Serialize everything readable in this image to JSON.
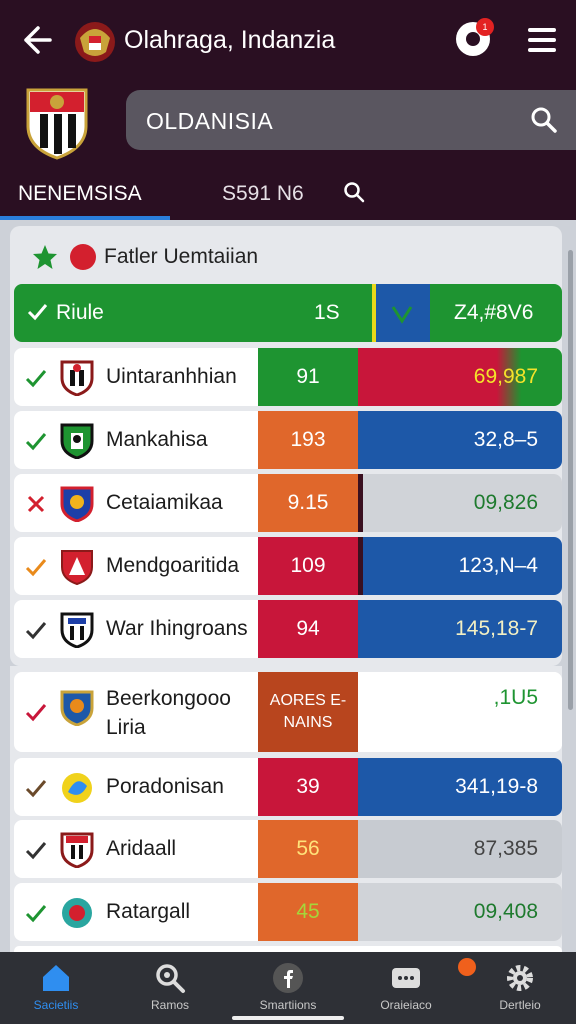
{
  "header": {
    "title": "Olahraga, Indanzia",
    "notification_count": "1",
    "search_value": "OLDANISIA",
    "tabs": [
      {
        "label": "NENEMSISA"
      },
      {
        "label": "S591 N6"
      }
    ]
  },
  "panel": {
    "title": "Fatler Uemtaiian",
    "header_row": {
      "label": "Riule",
      "count": "1S",
      "value": "Z4,#8V6"
    }
  },
  "rows": [
    {
      "mark": "check",
      "team": "Uintaranhhian",
      "count": "91",
      "score": "69,987"
    },
    {
      "mark": "check",
      "team": "Mankahisa",
      "count": "193",
      "score": "32,8–5"
    },
    {
      "mark": "cross",
      "team": "Cetaiamikaa",
      "count": "9.15",
      "score": "09,826"
    },
    {
      "mark": "check",
      "team": "Mendgoaritida",
      "count": "109",
      "score": "123,N–4"
    },
    {
      "mark": "check",
      "team": "War Ihingroans",
      "count": "94",
      "score": "145,18-7"
    },
    {
      "mark": "check",
      "team": "Beerkongooo Liria",
      "count": "AORES E-NAINS",
      "score": ",1U5"
    },
    {
      "mark": "check",
      "team": "Poradonisan",
      "count": "39",
      "score": "341,19-8"
    },
    {
      "mark": "check",
      "team": "Aridaall",
      "count": "56",
      "score": "87,385"
    },
    {
      "mark": "check",
      "team": "Ratargall",
      "count": "45",
      "score": "09,408"
    }
  ],
  "nav": [
    {
      "label": "Sacietiis",
      "icon": "home-icon"
    },
    {
      "label": "Ramos",
      "icon": "search-person-icon"
    },
    {
      "label": "Smartiions",
      "icon": "facebook-icon"
    },
    {
      "label": "Oraieiaco",
      "icon": "chat-icon"
    },
    {
      "label": "Dertleio",
      "icon": "gear-icon"
    }
  ],
  "colors": {
    "header_bg": "#2a0f22",
    "green": "#1e9431",
    "blue": "#1d58a8",
    "red": "#c8163a",
    "orange": "#e0672b",
    "nav_active": "#2f8ef0"
  }
}
